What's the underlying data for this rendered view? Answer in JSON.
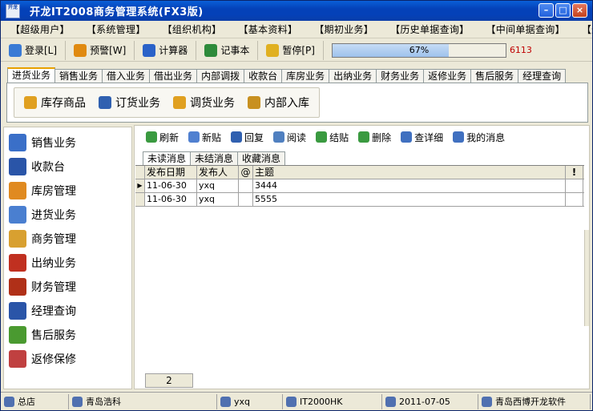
{
  "window": {
    "title": "开龙IT2008商务管理系统(FX3版)",
    "icon_text": "开龙"
  },
  "menubar": [
    "【超级用户】",
    "【系统管理】",
    "【组织机构】",
    "【基本资料】",
    "【期初业务】",
    "【历史单据查询】",
    "【中间单据查询】",
    "【返修查询】"
  ],
  "toolbar": {
    "buttons": [
      {
        "label": "登录[L]",
        "icon": "user-login-icon",
        "color": "#3a7bd5"
      },
      {
        "label": "预警[W]",
        "icon": "alarm-clock-icon",
        "color": "#e08a10"
      },
      {
        "label": "计算器",
        "icon": "calculator-icon",
        "color": "#2a62c8"
      },
      {
        "label": "记事本",
        "icon": "notepad-icon",
        "color": "#2e8b3b"
      },
      {
        "label": "暂停[P]",
        "icon": "lock-icon",
        "color": "#e0b020"
      }
    ],
    "progress_value": 67,
    "progress_text": "67%",
    "status_number": "6113"
  },
  "module_tabs": [
    "进货业务",
    "销售业务",
    "借入业务",
    "借出业务",
    "内部调拨",
    "收款台",
    "库房业务",
    "出纳业务",
    "财务业务",
    "返修业务",
    "售后服务",
    "经理查询"
  ],
  "active_module_tab": 0,
  "sub_toolbar": [
    {
      "label": "库存商品",
      "icon": "database-icon",
      "color": "#e0a020"
    },
    {
      "label": "订货业务",
      "icon": "document-icon",
      "color": "#3060b0"
    },
    {
      "label": "调货业务",
      "icon": "transfer-icon",
      "color": "#e0a020"
    },
    {
      "label": "内部入库",
      "icon": "inbound-icon",
      "color": "#c89020"
    }
  ],
  "sidebar": [
    {
      "label": "销售业务",
      "icon": "sales-icon",
      "color": "#3a6fc8"
    },
    {
      "label": "收款台",
      "icon": "cashier-icon",
      "color": "#2a55a8"
    },
    {
      "label": "库房管理",
      "icon": "warehouse-icon",
      "color": "#e08a20"
    },
    {
      "label": "进货业务",
      "icon": "purchase-icon",
      "color": "#4a7fd0"
    },
    {
      "label": "商务管理",
      "icon": "business-icon",
      "color": "#d8a030"
    },
    {
      "label": "出纳业务",
      "icon": "teller-icon",
      "color": "#c03020"
    },
    {
      "label": "财务管理",
      "icon": "finance-icon",
      "color": "#b03018"
    },
    {
      "label": "经理查询",
      "icon": "report-icon",
      "color": "#2a55a8"
    },
    {
      "label": "售后服务",
      "icon": "service-icon",
      "color": "#4a9a30"
    },
    {
      "label": "返修保修",
      "icon": "repair-icon",
      "color": "#c04040"
    }
  ],
  "message_panel": {
    "buttons": [
      {
        "label": "刷新",
        "icon": "refresh-icon",
        "color": "#3a9a40"
      },
      {
        "label": "新贴",
        "icon": "new-post-icon",
        "color": "#5080d0"
      },
      {
        "label": "回复",
        "icon": "reply-icon",
        "color": "#3060b0"
      },
      {
        "label": "阅读",
        "icon": "read-mail-icon",
        "color": "#5080c0"
      },
      {
        "label": "结贴",
        "icon": "close-post-icon",
        "color": "#3a9a40"
      },
      {
        "label": "删除",
        "icon": "delete-icon",
        "color": "#3a9a40"
      },
      {
        "label": "查详细",
        "icon": "detail-icon",
        "color": "#4070c0"
      },
      {
        "label": "我的消息",
        "icon": "search-message-icon",
        "color": "#4070c0"
      }
    ],
    "tabs": [
      "未读消息",
      "未结消息",
      "收藏消息"
    ],
    "active_tab": 0,
    "columns": [
      "发布日期",
      "发布人",
      "@",
      "主题",
      "!"
    ],
    "rows": [
      {
        "date": "11-06-30",
        "author": "yxq",
        "attach": "",
        "subject": "3444",
        "flag": "",
        "current": true
      },
      {
        "date": "11-06-30",
        "author": "yxq",
        "attach": "",
        "subject": "5555",
        "flag": "",
        "current": false
      }
    ],
    "record_count": "2"
  },
  "statusbar": [
    {
      "label": "总店",
      "icon": "store-icon"
    },
    {
      "label": "青岛浩科",
      "icon": "company-icon"
    },
    {
      "label": "yxq",
      "icon": "user-icon"
    },
    {
      "label": "IT2000HK",
      "icon": "database-icon"
    },
    {
      "label": "2011-07-05",
      "icon": "clock-icon"
    },
    {
      "label": "青岛西博开龙软件",
      "icon": "vendor-icon"
    }
  ]
}
